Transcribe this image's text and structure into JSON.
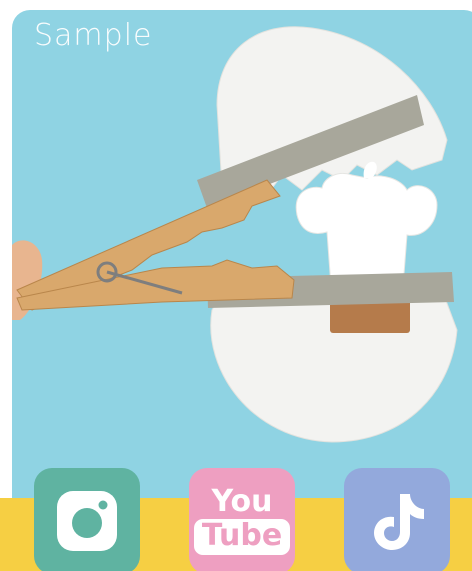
{
  "watermark": {
    "text": "Sample"
  },
  "photo": {
    "description_icon": "craft-photo-image",
    "colors": {
      "background": "#8fd3e3",
      "eggshell": "#f3f3f1",
      "cardboard_strip": "#a8a79b",
      "clothespin": "#d9a86c",
      "chick": "#ffffff"
    }
  },
  "social": {
    "instagram": {
      "icon": "instagram-icon",
      "color": "#5fb3a1"
    },
    "youtube": {
      "you_label": "You",
      "tube_label": "Tube",
      "color": "#ee9fc1"
    },
    "tiktok": {
      "icon": "tiktok-icon",
      "color": "#93a9dc"
    }
  },
  "footer": {
    "color": "#f6cf43"
  }
}
